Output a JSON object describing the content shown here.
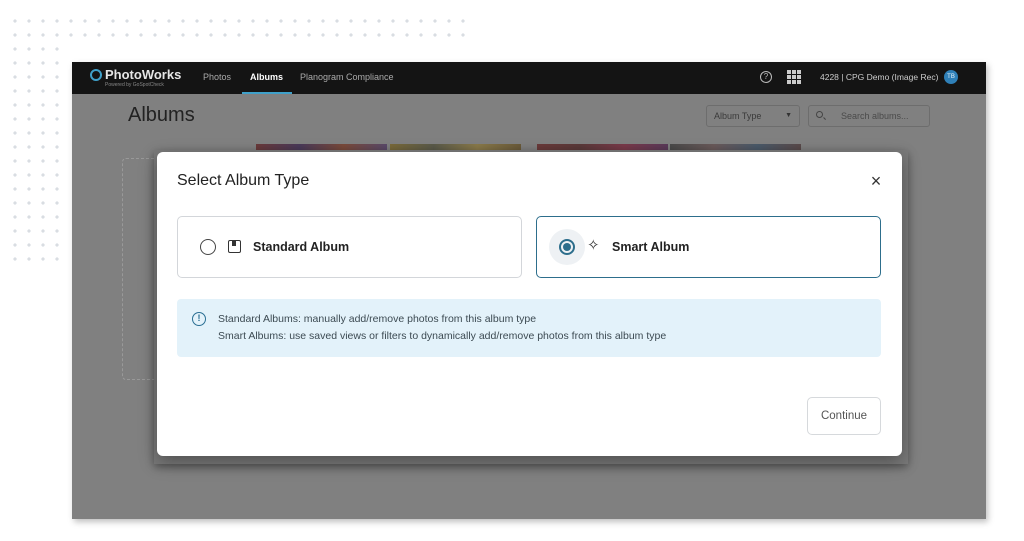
{
  "app": {
    "logo_text": "PhotoWorks",
    "logo_sub": "Powered by GoSpotCheck",
    "nav": [
      {
        "label": "Photos"
      },
      {
        "label": "Albums"
      },
      {
        "label": "Planogram Compliance"
      }
    ],
    "active_nav": "Albums",
    "account_label": "4228 | CPG Demo (Image Rec)",
    "avatar_initials": "TB",
    "accent_color": "#3fa0c9"
  },
  "page": {
    "title": "Albums",
    "album_type_select": "Album Type",
    "search_placeholder": "Search albums..."
  },
  "modal": {
    "title": "Select Album Type",
    "close_glyph": "×",
    "options": [
      {
        "label": "Standard Album",
        "icon": "book-icon",
        "selected": false
      },
      {
        "label": "Smart Album",
        "icon": "sparkle-icon",
        "selected": true
      }
    ],
    "info_lines": [
      "Standard Albums: manually add/remove photos from this album type",
      "Smart Albums: use saved views or filters to dynamically add/remove photos from this album type"
    ],
    "continue_label": "Continue",
    "selected_color": "#2d6e8c",
    "info_bg_color": "#e3f2fa"
  }
}
